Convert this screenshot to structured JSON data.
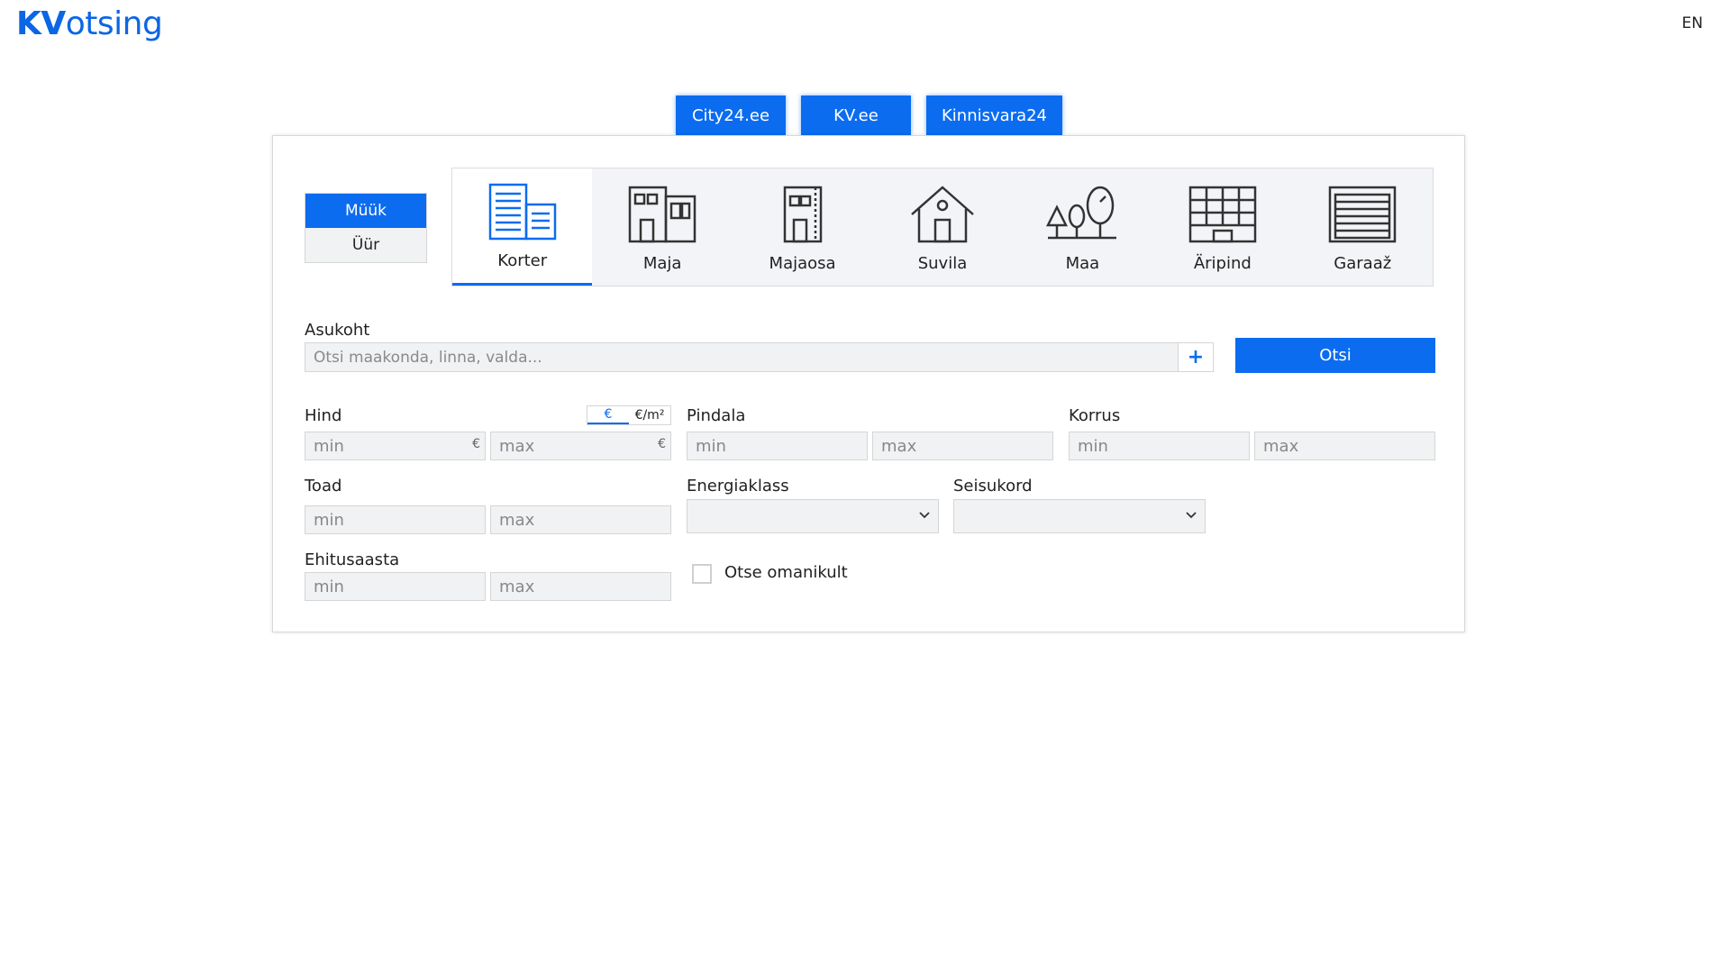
{
  "header": {
    "logo_bold": "KV",
    "logo_rest": "otsing",
    "language": "EN"
  },
  "portals": [
    {
      "label": "City24.ee"
    },
    {
      "label": "KV.ee"
    },
    {
      "label": "Kinnisvara24"
    }
  ],
  "deal_types": [
    {
      "label": "Müük",
      "active": true
    },
    {
      "label": "Üür",
      "active": false
    }
  ],
  "property_types": [
    {
      "label": "Korter",
      "icon": "apartment-icon",
      "active": true
    },
    {
      "label": "Maja",
      "icon": "house-icon",
      "active": false
    },
    {
      "label": "Majaosa",
      "icon": "house-part-icon",
      "active": false
    },
    {
      "label": "Suvila",
      "icon": "cottage-icon",
      "active": false
    },
    {
      "label": "Maa",
      "icon": "land-icon",
      "active": false
    },
    {
      "label": "Äripind",
      "icon": "commercial-icon",
      "active": false
    },
    {
      "label": "Garaaž",
      "icon": "garage-icon",
      "active": false
    }
  ],
  "location": {
    "label": "Asukoht",
    "placeholder": "Otsi maakonda, linna, valda...",
    "add_icon": "plus-icon"
  },
  "search_button": "Otsi",
  "price": {
    "label": "Hind",
    "currency_options": [
      "€",
      "€/m²"
    ],
    "min": "min",
    "max": "max",
    "unit": "€"
  },
  "area": {
    "label": "Pindala",
    "min": "min",
    "max": "max"
  },
  "floor": {
    "label": "Korrus",
    "min": "min",
    "max": "max"
  },
  "rooms": {
    "label": "Toad",
    "min": "min",
    "max": "max"
  },
  "energy_class": {
    "label": "Energiaklass"
  },
  "condition": {
    "label": "Seisukord"
  },
  "build_year": {
    "label": "Ehitusaasta",
    "min": "min",
    "max": "max"
  },
  "owner_direct": {
    "label": "Otse omanikult",
    "checked": false
  },
  "colors": {
    "accent": "#0b6cf0",
    "field_bg": "#f1f2f4",
    "border": "#d5d5d5"
  }
}
